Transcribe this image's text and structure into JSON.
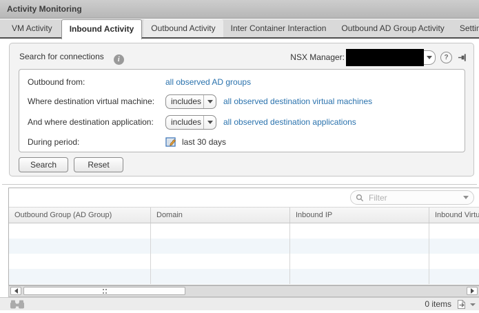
{
  "window": {
    "title": "Activity Monitoring"
  },
  "tabs": [
    {
      "label": "VM Activity"
    },
    {
      "label": "Inbound Activity",
      "active": true
    },
    {
      "label": "Outbound Activity"
    },
    {
      "label": "Inter Container Interaction"
    },
    {
      "label": "Outbound AD Group Activity"
    },
    {
      "label": "Settings"
    }
  ],
  "search_panel": {
    "title": "Search for connections",
    "nsx_manager": {
      "label": "NSX Manager:",
      "value_redacted": true
    },
    "form": {
      "outbound_from": {
        "label": "Outbound from:",
        "link": "all observed AD groups"
      },
      "destination_vm": {
        "label": "Where destination virtual machine:",
        "operator": "includes",
        "link": "all observed destination virtual machines"
      },
      "destination_app": {
        "label": "And where destination application:",
        "operator": "includes",
        "link": "all observed destination applications"
      },
      "period": {
        "label": "During period:",
        "value": "last 30 days"
      }
    },
    "buttons": {
      "search": "Search",
      "reset": "Reset"
    }
  },
  "table": {
    "filter": {
      "placeholder": "Filter"
    },
    "columns": [
      "Outbound Group (AD Group)",
      "Domain",
      "Inbound IP",
      "Inbound Virtual Machine"
    ],
    "rows": [],
    "status": {
      "items_count": "0 items"
    }
  },
  "icons": {
    "info": "i",
    "help": "?"
  },
  "colors": {
    "link": "#2a72ad",
    "row_alt": "#f1f6fa",
    "tab_band": "#4f4f4f"
  }
}
